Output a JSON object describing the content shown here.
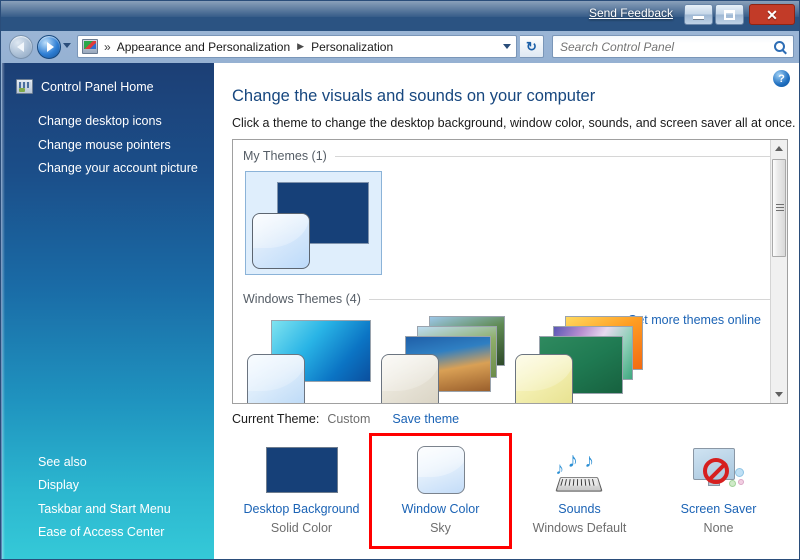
{
  "titlebar": {
    "send_feedback": "Send Feedback",
    "minimize_label": "Minimize",
    "maximize_label": "Maximize",
    "close_label": "Close"
  },
  "navbar": {
    "back_label": "Back",
    "forward_label": "Forward",
    "breadcrumb": [
      "Appearance and Personalization",
      "Personalization"
    ],
    "separator": "»",
    "crumb_arrow": "▶",
    "refresh_glyph": "↻",
    "search": {
      "placeholder": "Search Control Panel",
      "value": ""
    }
  },
  "sidebar": {
    "home": "Control Panel Home",
    "items": [
      {
        "label": "Change desktop icons"
      },
      {
        "label": "Change mouse pointers"
      },
      {
        "label": "Change your account picture"
      }
    ],
    "see_also_title": "See also",
    "see_also_items": [
      {
        "label": "Display"
      },
      {
        "label": "Taskbar and Start Menu"
      },
      {
        "label": "Ease of Access Center"
      }
    ]
  },
  "content": {
    "help_glyph": "?",
    "title": "Change the visuals and sounds on your computer",
    "subtitle": "Click a theme to change the desktop background, window color, sounds, and screen saver all at once.",
    "groups": [
      {
        "title": "My Themes (1)"
      },
      {
        "title": "Windows Themes (4)"
      }
    ],
    "get_more_themes": "Get more themes online",
    "current_theme_label": "Current Theme:",
    "current_theme_value": "Custom",
    "save_theme": "Save theme",
    "options": [
      {
        "title": "Desktop Background",
        "value": "Solid Color",
        "icon": "desktop-background-icon"
      },
      {
        "title": "Window Color",
        "value": "Sky",
        "icon": "window-color-icon"
      },
      {
        "title": "Sounds",
        "value": "Windows Default",
        "icon": "sounds-icon"
      },
      {
        "title": "Screen Saver",
        "value": "None",
        "icon": "screen-saver-icon"
      }
    ]
  },
  "colors": {
    "accent_link": "#1b63b5",
    "title_text": "#17477f",
    "sidebar_top": "#1c3f75",
    "sidebar_bottom": "#35c9d8",
    "highlight_box": "#ff0000",
    "solid_color_navy": "#164078"
  }
}
